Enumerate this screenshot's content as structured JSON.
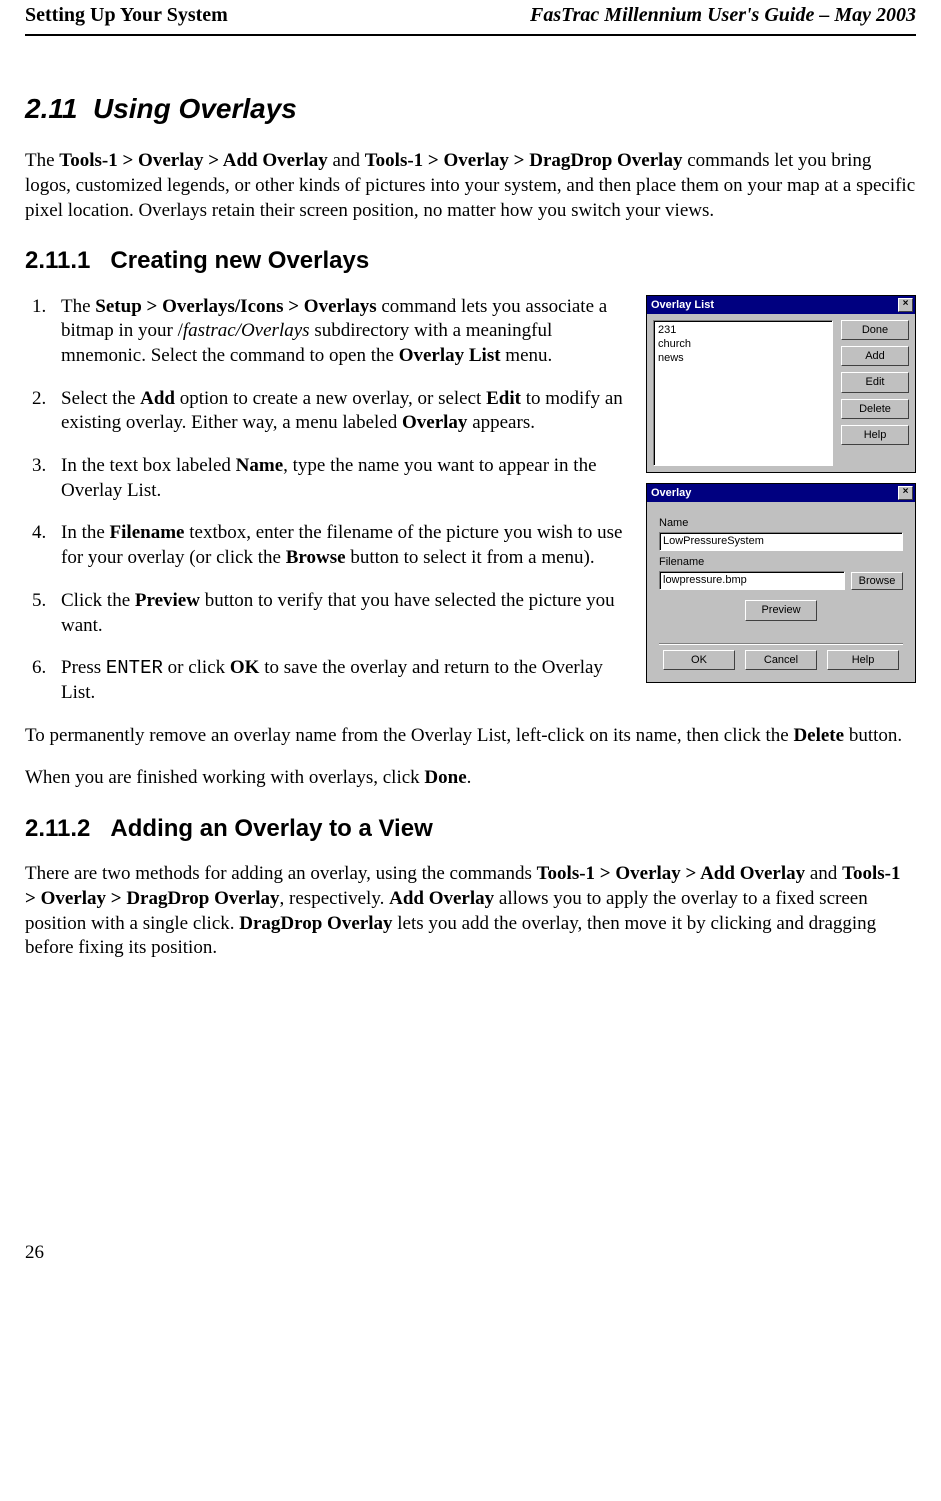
{
  "header": {
    "left": "Setting Up Your System",
    "right": "FasTrac Millennium User's Guide – May 2003"
  },
  "section": {
    "num": "2.11",
    "title": "Using Overlays",
    "intro": {
      "t1": "The ",
      "b1": "Tools-1 > Overlay > Add Overlay",
      "t2": " and ",
      "b2": "Tools-1 > Overlay > DragDrop Overlay",
      "t3": " commands let you bring logos, customized legends, or other kinds of pictures into your system, and then place them on your map at a specific pixel location. Overlays retain their screen position, no matter how you switch your views."
    }
  },
  "sub1": {
    "num": "2.11.1",
    "title": "Creating new Overlays"
  },
  "steps": {
    "s1": {
      "a": "The ",
      "b": "Setup > Overlays/Icons > Overlays",
      "c": " command lets you associate a bitmap in your /",
      "i": "fastrac/Overlays",
      "d": " subdirectory with a meaningful mnemonic. Select the command to open the ",
      "e": "Overlay List",
      "f": " menu."
    },
    "s2": {
      "a": "Select the ",
      "b": "Add",
      "c": " option to create a new overlay, or select ",
      "d": "Edit",
      "e": " to modify an existing overlay. Either way, a menu labeled ",
      "f": "Overlay",
      "g": " appears."
    },
    "s3": {
      "a": "In the text box labeled ",
      "b": "Name",
      "c": ", type the name you want to appear in the Overlay List."
    },
    "s4": {
      "a": "In the ",
      "b": "Filename",
      "c": " textbox, enter the filename of the picture you wish to use for your overlay (or click the ",
      "d": "Browse",
      "e": " button to select it from a menu)."
    },
    "s5": {
      "a": "Click the ",
      "b": "Preview",
      "c": " button to verify that you have selected the picture you want."
    },
    "s6": {
      "a": "Press ",
      "m": "ENTER",
      "b": " or click ",
      "c": "OK",
      "d": " to save the overlay and return to the Overlay List."
    }
  },
  "after": {
    "p1a": "To permanently remove an overlay name from the Overlay List, left-click on its name, then click the ",
    "p1b": "Delete",
    "p1c": " button.",
    "p2a": "When you are finished working with overlays, click ",
    "p2b": "Done",
    "p2c": "."
  },
  "sub2": {
    "num": "2.11.2",
    "title": "Adding an Overlay to a View",
    "p": {
      "a": "There are two methods for adding an overlay, using the commands ",
      "b": "Tools-1 > Overlay > Add Overlay",
      "c": " and ",
      "d": "Tools-1 > Overlay > DragDrop Overlay",
      "e": ", respectively. ",
      "f": "Add Overlay",
      "g": " allows you to apply the overlay to a fixed screen position with a single click. ",
      "h": "DragDrop Overlay",
      "i": " lets you add the overlay, then move it by clicking and dragging before fixing its position."
    }
  },
  "dlg1": {
    "title": "Overlay List",
    "items": [
      "231",
      "church",
      "news"
    ],
    "btns": {
      "done": "Done",
      "add": "Add",
      "edit": "Edit",
      "del": "Delete",
      "help": "Help"
    }
  },
  "dlg2": {
    "title": "Overlay",
    "nameLbl": "Name",
    "nameVal": "LowPressureSystem",
    "fileLbl": "Filename",
    "fileVal": "lowpressure.bmp",
    "browse": "Browse",
    "preview": "Preview",
    "ok": "OK",
    "cancel": "Cancel",
    "help": "Help"
  },
  "page": "26",
  "closeX": "×"
}
